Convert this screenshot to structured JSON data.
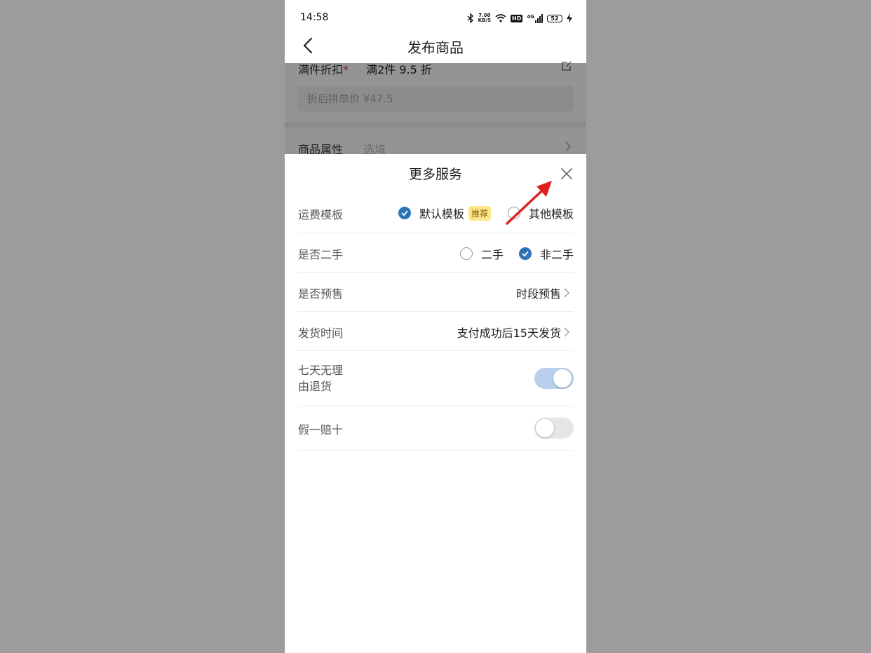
{
  "status_bar": {
    "time": "14:58",
    "speed_value": "7.00",
    "speed_unit": "KB/S",
    "hd": "HD",
    "network": "4G",
    "battery": "52"
  },
  "nav": {
    "title": "发布商品",
    "back_icon": "chevron-left-icon"
  },
  "background_form": {
    "discount_label": "满件折扣",
    "required_mark": "*",
    "discount_value": "满2件 9.5 折",
    "discount_price_placeholder": "折后拼单价 ¥47.5",
    "attributes_label": "商品属性",
    "attributes_placeholder": "选填"
  },
  "sheet": {
    "title": "更多服务",
    "close_icon": "close-icon",
    "rows": [
      {
        "label": "运费模板",
        "options": [
          {
            "label": "默认模板",
            "checked": true,
            "tag": "推荐"
          },
          {
            "label": "其他模板",
            "checked": false
          }
        ]
      },
      {
        "label": "是否二手",
        "options": [
          {
            "label": "二手",
            "checked": false
          },
          {
            "label": "非二手",
            "checked": true
          }
        ]
      },
      {
        "label": "是否预售",
        "value": "时段预售"
      },
      {
        "label": "发货时间",
        "value": "支付成功后15天发货"
      },
      {
        "label_line1": "七天无理",
        "label_line2": "由退货",
        "toggle": true
      },
      {
        "label": "假一赔十",
        "toggle": false
      }
    ]
  },
  "colors": {
    "accent": "#2e72b8",
    "tag_bg": "#fde58a",
    "annotation_arrow": "#e02020"
  }
}
